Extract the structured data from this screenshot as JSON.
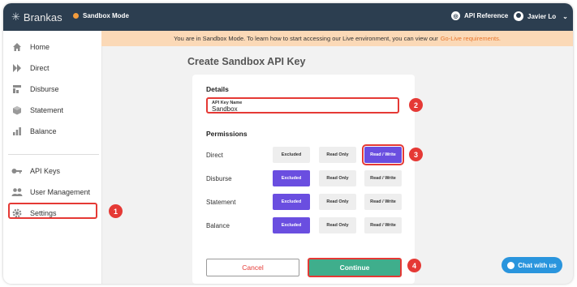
{
  "topbar": {
    "brand": "Brankas",
    "mode": "Sandbox Mode",
    "api_reference": "API Reference",
    "user_name": "Javier Lo"
  },
  "sidebar": {
    "items": [
      {
        "label": "Home",
        "icon": "home-icon"
      },
      {
        "label": "Direct",
        "icon": "direct-arrows-icon"
      },
      {
        "label": "Disburse",
        "icon": "disburse-icon"
      },
      {
        "label": "Statement",
        "icon": "statement-cube-icon"
      },
      {
        "label": "Balance",
        "icon": "balance-bars-icon"
      },
      {
        "label": "API Keys",
        "icon": "key-icon"
      },
      {
        "label": "User Management",
        "icon": "users-icon"
      },
      {
        "label": "Settings",
        "icon": "gear-icon"
      }
    ]
  },
  "banner": {
    "text": "You are in Sandbox Mode. To learn how to start accessing our Live environment, you can view our",
    "link": "Go-Live requirements."
  },
  "page": {
    "title": "Create Sandbox API Key"
  },
  "form": {
    "details_label": "Details",
    "api_key_name_label": "API Key Name",
    "api_key_name_value": "Sandbox",
    "permissions_label": "Permissions",
    "permissions": [
      {
        "name": "Direct",
        "selected": "Read / Write"
      },
      {
        "name": "Disburse",
        "selected": "Excluded"
      },
      {
        "name": "Statement",
        "selected": "Excluded"
      },
      {
        "name": "Balance",
        "selected": "Excluded"
      }
    ],
    "options": [
      "Excluded",
      "Read Only",
      "Read / Write"
    ],
    "cancel_label": "Cancel",
    "continue_label": "Continue"
  },
  "annotations": [
    "1",
    "2",
    "3",
    "4"
  ],
  "chat": {
    "label": "Chat with us"
  },
  "colors": {
    "topbar": "#2c3e50",
    "accent_purple": "#6a4ee0",
    "continue_green": "#3fae8c",
    "highlight_red": "#e53935",
    "banner_bg": "#fbd9b7",
    "banner_link": "#e8762c",
    "chat_blue": "#2a95dd"
  }
}
